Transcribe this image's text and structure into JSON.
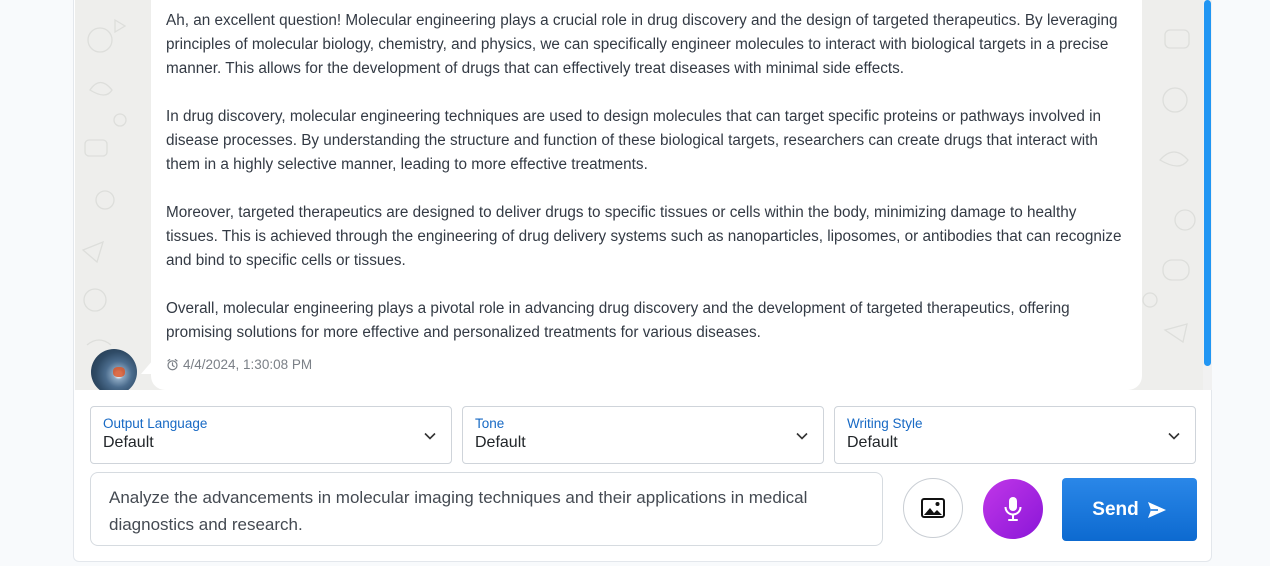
{
  "message": {
    "paragraphs": [
      "Ah, an excellent question! Molecular engineering plays a crucial role in drug discovery and the design of targeted therapeutics. By leveraging principles of molecular biology, chemistry, and physics, we can specifically engineer molecules to interact with biological targets in a precise manner. This allows for the development of drugs that can effectively treat diseases with minimal side effects.",
      "In drug discovery, molecular engineering techniques are used to design molecules that can target specific proteins or pathways involved in disease processes. By understanding the structure and function of these biological targets, researchers can create drugs that interact with them in a highly selective manner, leading to more effective treatments.",
      "Moreover, targeted therapeutics are designed to deliver drugs to specific tissues or cells within the body, minimizing damage to healthy tissues. This is achieved through the engineering of drug delivery systems such as nanoparticles, liposomes, or antibodies that can recognize and bind to specific cells or tissues.",
      "Overall, molecular engineering plays a pivotal role in advancing drug discovery and the development of targeted therapeutics, offering promising solutions for more effective and personalized treatments for various diseases."
    ],
    "timestamp": "4/4/2024, 1:30:08 PM"
  },
  "selects": [
    {
      "label": "Output Language",
      "value": "Default"
    },
    {
      "label": "Tone",
      "value": "Default"
    },
    {
      "label": "Writing Style",
      "value": "Default"
    }
  ],
  "composer": {
    "text": "Analyze the advancements in molecular imaging techniques and their applications in medical diagnostics and research.",
    "send_label": "Send"
  },
  "icons": {
    "timestamp": "alarm-clock-icon",
    "image_button": "image-icon",
    "mic_button": "microphone-icon",
    "send": "send-arrow-icon",
    "chevron": "chevron-down-icon"
  },
  "colors": {
    "accent": "#1769c4",
    "send_button": "#1473dc",
    "mic_button": "#a424e0",
    "scrollbar": "#2196f3"
  }
}
